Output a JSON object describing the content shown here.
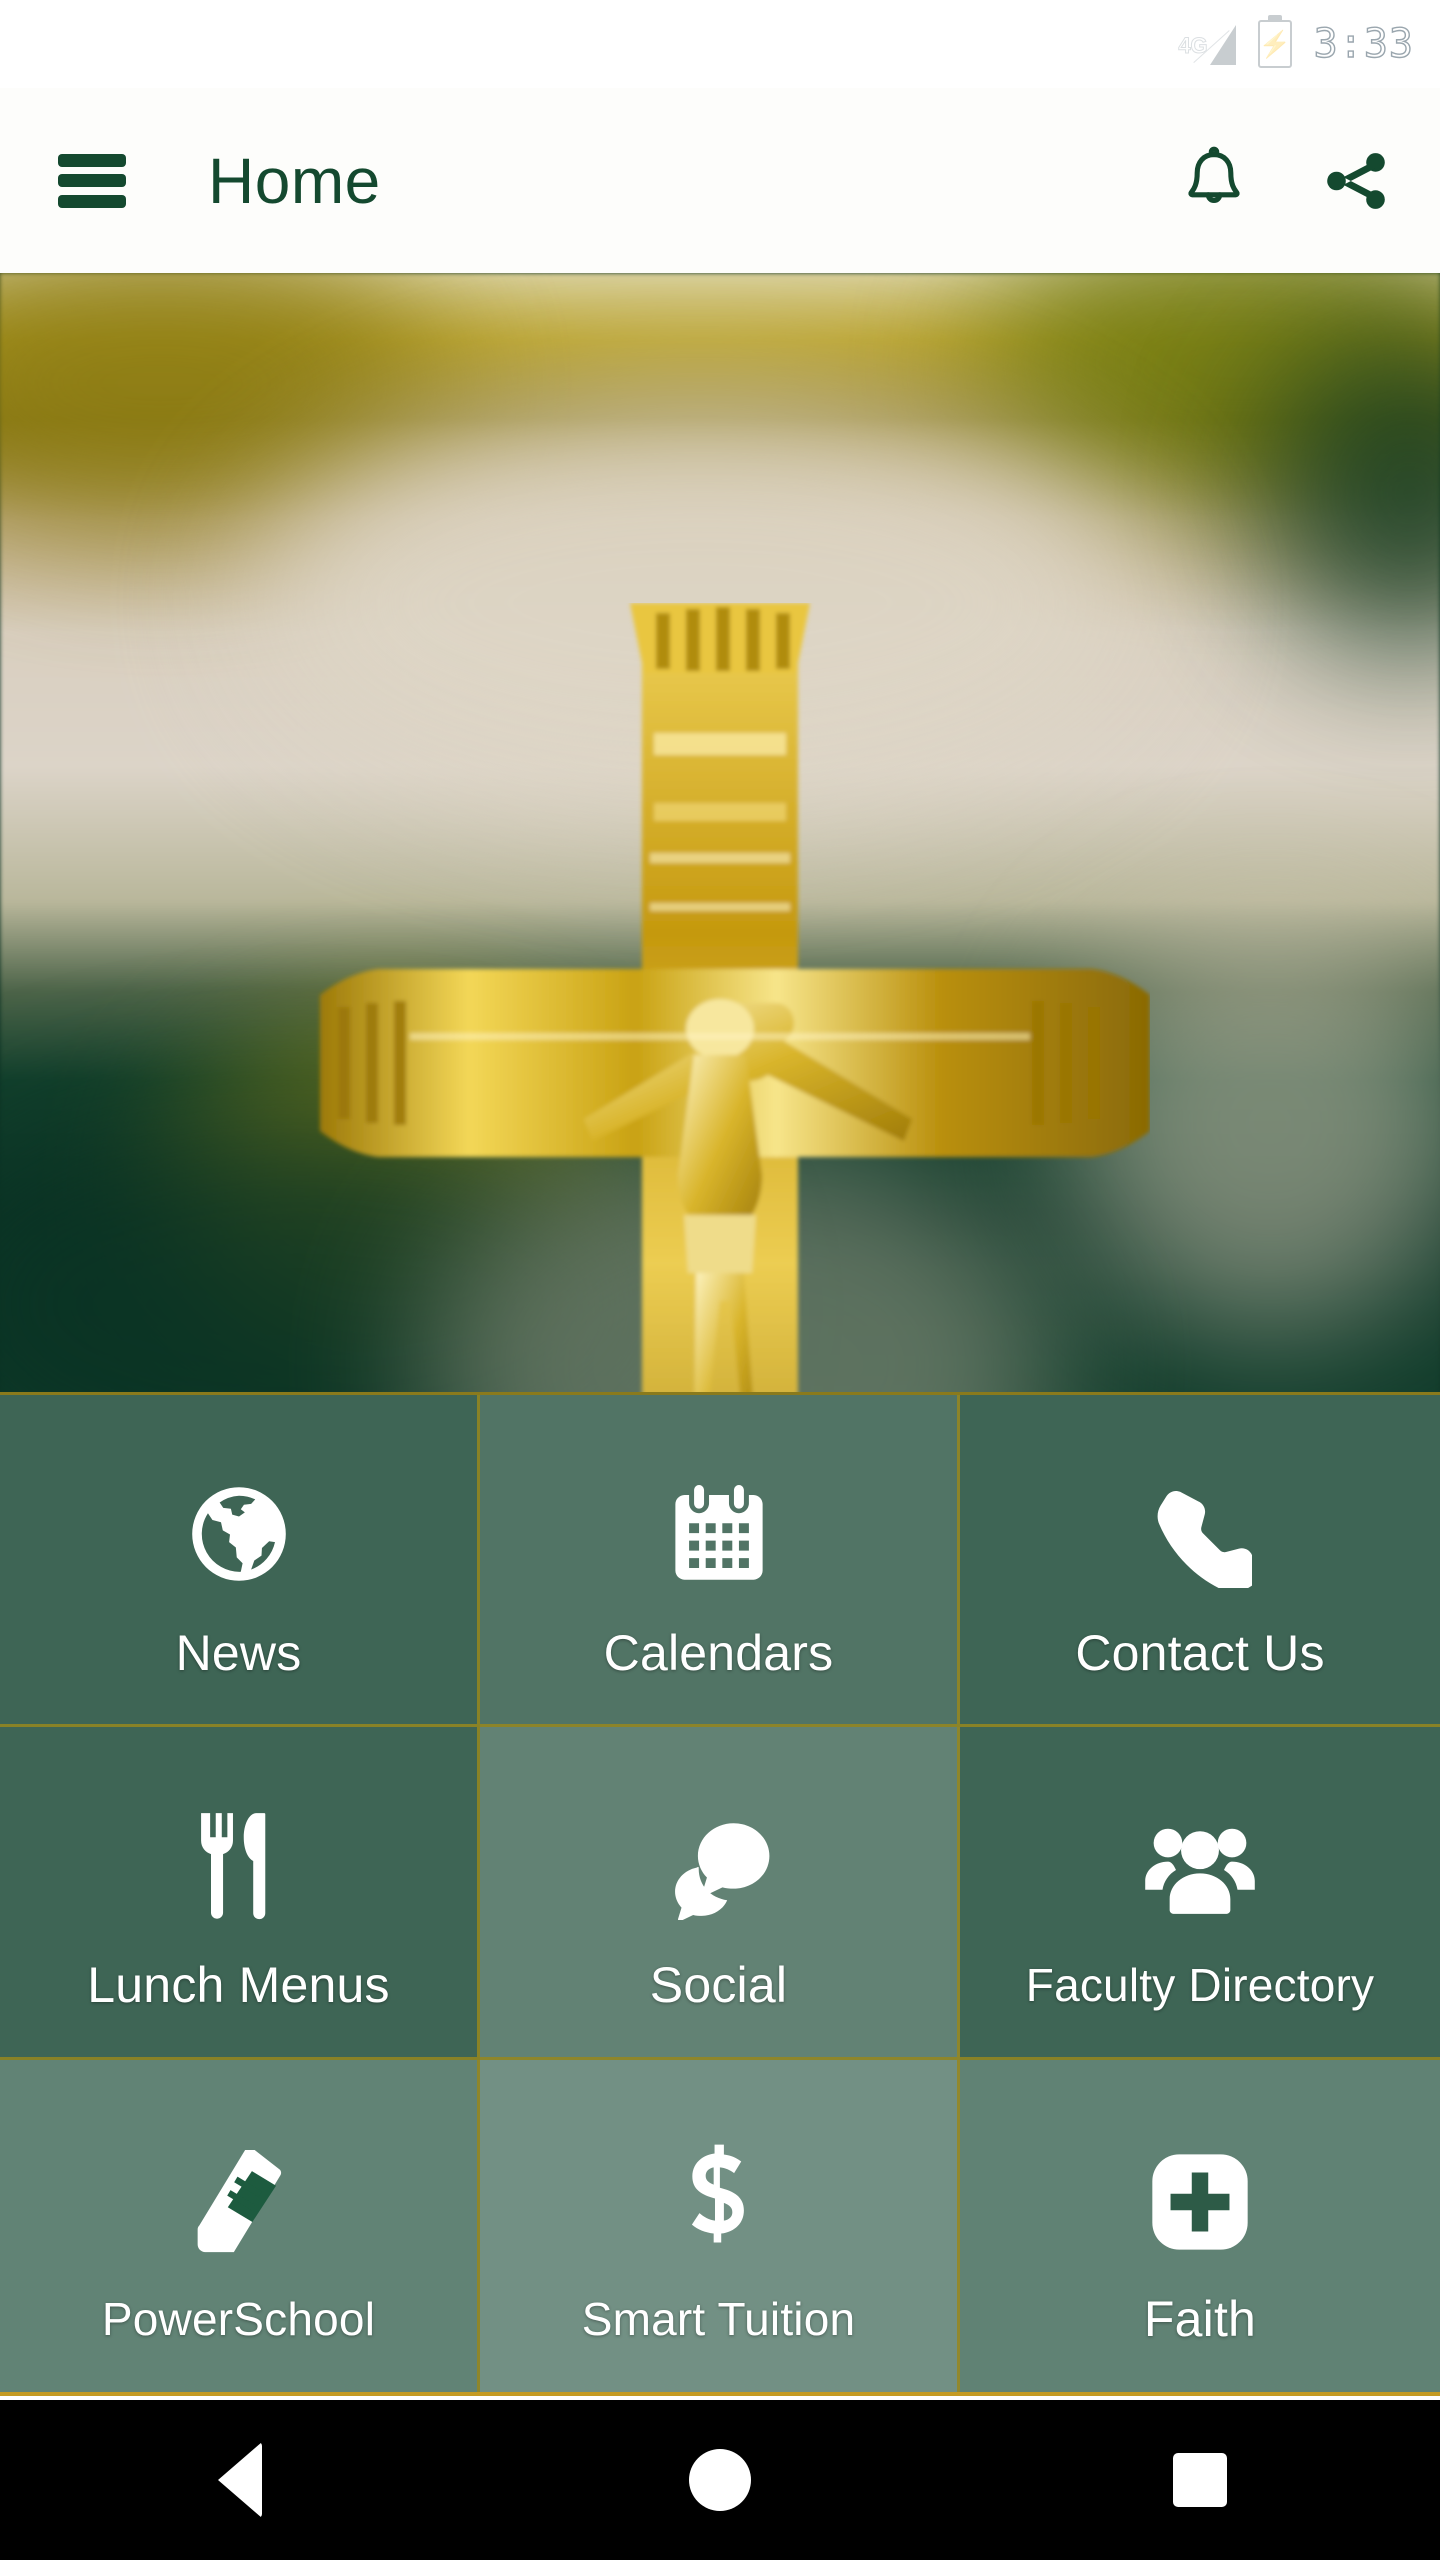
{
  "status_bar": {
    "network_label": "4G",
    "signal_icon": "signal-triangle-icon",
    "battery_icon": "battery-charging-icon",
    "battery_bolt": "⚡",
    "time": "3:33"
  },
  "app_bar": {
    "menu_icon": "hamburger-menu-icon",
    "title": "Home",
    "notifications_icon": "bell-icon",
    "share_icon": "share-icon"
  },
  "hero": {
    "alt": "Golden crucifix on blurred gold and green background",
    "image_name": "crucifix-hero-image"
  },
  "colors": {
    "brand_green": "#14492f",
    "tile_green": "#0e3e2a",
    "divider_gold": "#968720",
    "border_gold": "#c49a22",
    "tile_text": "#ffffff",
    "navbar_black": "#000000",
    "appbar_bg": "#fdfdfb"
  },
  "tiles": [
    {
      "label": "News",
      "icon": "globe-icon"
    },
    {
      "label": "Calendars",
      "icon": "calendar-icon"
    },
    {
      "label": "Contact Us",
      "icon": "phone-icon"
    },
    {
      "label": "Lunch Menus",
      "icon": "fork-knife-icon"
    },
    {
      "label": "Social",
      "icon": "chat-bubbles-icon"
    },
    {
      "label": "Faculty Directory",
      "icon": "people-group-icon"
    },
    {
      "label": "PowerSchool",
      "icon": "book-icon"
    },
    {
      "label": "Smart Tuition",
      "icon": "dollar-sign-icon"
    },
    {
      "label": "Faith",
      "icon": "cross-plus-icon"
    }
  ],
  "nav_bar": {
    "back": "back-button",
    "home": "home-button",
    "recents": "recents-button"
  }
}
